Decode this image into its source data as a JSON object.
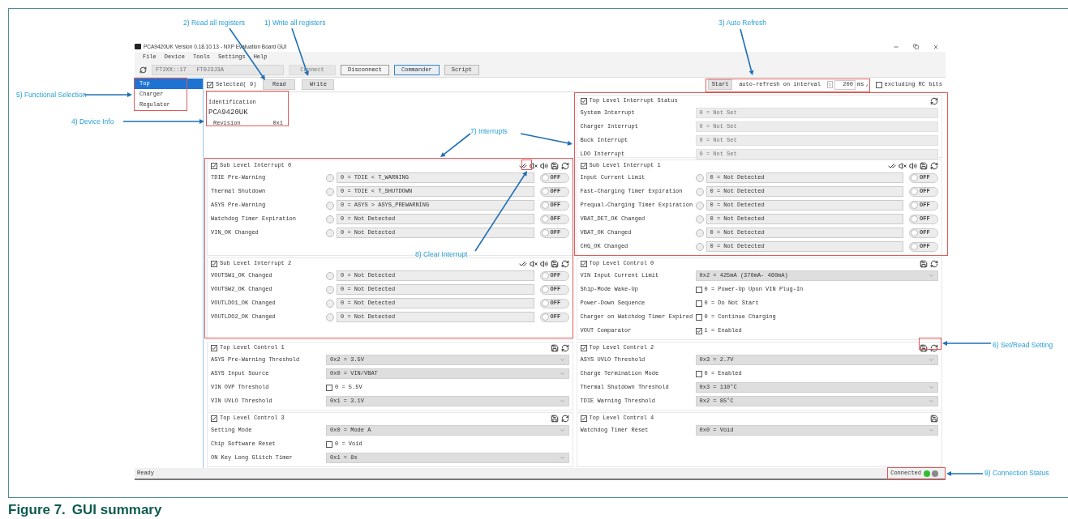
{
  "annotations": [
    {
      "text": "2) Read all registers"
    },
    {
      "text": "1) Write all registers"
    },
    {
      "text": "3) Auto Refresh"
    },
    {
      "text": "5) Functional Selection"
    },
    {
      "text": "4) Device Info"
    },
    {
      "text": "7) Interrupts"
    },
    {
      "text": "8) Clear Interrupt"
    },
    {
      "text": "6) Set/Read Setting"
    },
    {
      "text": "9) Connection Status"
    }
  ],
  "window": {
    "title": "PCA9420UK Version 0.18.10.13 - NXP Evaluation Board GUI"
  },
  "menu": [
    "File",
    "Device",
    "Tools",
    "Settings",
    "Help"
  ],
  "toolbar": {
    "device_combo": "FT2XX::17   FT0J3J3A",
    "connect_button": {
      "label": "Connect",
      "disabled": true
    },
    "disconnect_button": {
      "label": "Disconnect",
      "disabled": false
    },
    "mode_tabs": [
      {
        "label": "Commander",
        "selected": true
      },
      {
        "label": "Script",
        "selected": false
      }
    ]
  },
  "sidebar": {
    "items": [
      {
        "label": "Top",
        "selected": true
      },
      {
        "label": "Charger",
        "selected": false
      },
      {
        "label": "Regulator",
        "selected": false
      }
    ]
  },
  "register_bar": {
    "selected_checkbox": {
      "label": "Selected( 9)",
      "checked": true
    },
    "read_button": "Read",
    "write_button": "Write",
    "start_button": "Start",
    "interval_label": "auto-refresh on interval",
    "interval_value": "200",
    "unit": "ms",
    "separator": ",",
    "exclude_rc": {
      "label": "excluding RC bits",
      "checked": false
    }
  },
  "panels": [
    {
      "kind": "identification",
      "title": "Identification",
      "device": "PCA9420UK",
      "revision_label": "Revision",
      "revision_value": "0x1"
    },
    {
      "kind": "group",
      "title": "Top Level Interrupt Status",
      "checked": true,
      "tools": [
        {
          "kind": "refresh"
        }
      ],
      "rows": [
        {
          "kind": "status",
          "label": "System Interrupt",
          "value": "0 = Not Set"
        },
        {
          "kind": "status",
          "label": "Charger Interrupt",
          "value": "0 = Not Set"
        },
        {
          "kind": "status",
          "label": "Buck Interrupt",
          "value": "0 = Not Set"
        },
        {
          "kind": "status",
          "label": "LDO Interrupt",
          "value": "0 = Not Set"
        }
      ]
    },
    {
      "kind": "group",
      "title": "Sub Level Interrupt 0",
      "checked": true,
      "tools": [
        {
          "kind": "clear"
        },
        {
          "kind": "mute"
        },
        {
          "kind": "sound"
        },
        {
          "kind": "save"
        },
        {
          "kind": "refresh"
        }
      ],
      "rows": [
        {
          "kind": "interrupt",
          "label": "TDIE Pre-Warning",
          "value": "0 = TDIE < T_WARNING",
          "switch": "OFF",
          "on": false
        },
        {
          "kind": "interrupt",
          "label": "Thermal Shutdown",
          "value": "0 = TDIE < T_SHUTDOWN",
          "switch": "OFF",
          "on": false
        },
        {
          "kind": "interrupt",
          "label": "ASYS Pre-Warning",
          "value": "0 = ASYS > ASYS_PREWARNING",
          "switch": "OFF",
          "on": false
        },
        {
          "kind": "interrupt",
          "label": "Watchdog Timer Expiration",
          "value": "0 = Not Detected",
          "switch": "OFF",
          "on": false
        },
        {
          "kind": "interrupt",
          "label": "VIN_OK Changed",
          "value": "0 = Not Detected",
          "switch": "OFF",
          "on": false
        }
      ]
    },
    {
      "kind": "group",
      "title": "Sub Level Interrupt 1",
      "checked": true,
      "tools": [
        {
          "kind": "clear"
        },
        {
          "kind": "mute"
        },
        {
          "kind": "sound"
        },
        {
          "kind": "save"
        },
        {
          "kind": "refresh"
        }
      ],
      "rows": [
        {
          "kind": "interrupt",
          "label": "Input Current Limit",
          "value": "0 = Not Detected",
          "switch": "OFF",
          "on": false
        },
        {
          "kind": "interrupt",
          "label": "Fast-Charging Timer Expiration",
          "value": "0 = Not Detected",
          "switch": "OFF",
          "on": false
        },
        {
          "kind": "interrupt",
          "label": "Prequal-Charging Timer Expiration",
          "value": "0 = Not Detected",
          "switch": "OFF",
          "on": false
        },
        {
          "kind": "interrupt",
          "label": "VBAT_DET_OK Changed",
          "value": "0 = Not Detected",
          "switch": "OFF",
          "on": false
        },
        {
          "kind": "interrupt",
          "label": "VBAT_OK Changed",
          "value": "0 = Not Detected",
          "switch": "OFF",
          "on": false
        },
        {
          "kind": "interrupt",
          "label": "CHG_OK Changed",
          "value": "0 = Not Detected",
          "switch": "OFF",
          "on": false
        }
      ]
    },
    {
      "kind": "group",
      "title": "Sub Level Interrupt 2",
      "checked": true,
      "tools": [
        {
          "kind": "clear"
        },
        {
          "kind": "mute"
        },
        {
          "kind": "sound"
        },
        {
          "kind": "save"
        },
        {
          "kind": "refresh"
        }
      ],
      "rows": [
        {
          "kind": "interrupt",
          "label": "VOUTSW1_OK Changed",
          "value": "0 = Not Detected",
          "switch": "OFF",
          "on": false
        },
        {
          "kind": "interrupt",
          "label": "VOUTSW2_OK Changed",
          "value": "0 = Not Detected",
          "switch": "OFF",
          "on": false
        },
        {
          "kind": "interrupt",
          "label": "VOUTLDO1_OK Changed",
          "value": "0 = Not Detected",
          "switch": "OFF",
          "on": false
        },
        {
          "kind": "interrupt",
          "label": "VOUTLDO2_OK Changed",
          "value": "0 = Not Detected",
          "switch": "OFF",
          "on": false
        }
      ]
    },
    {
      "kind": "group",
      "title": "Top Level Control 0",
      "checked": true,
      "tools": [
        {
          "kind": "save"
        },
        {
          "kind": "refresh"
        }
      ],
      "rows": [
        {
          "kind": "select",
          "label": "VIN Input Current Limit",
          "value": "0x2 =  425mA (370mA- 460mA)"
        },
        {
          "kind": "checkbox",
          "label": "Ship-Mode Wake-Up",
          "value": "0 = Power-Up Upon VIN Plug-In",
          "checked": false
        },
        {
          "kind": "checkbox",
          "label": "Power-Down Sequence",
          "value": "0 = Do Not Start",
          "checked": false
        },
        {
          "kind": "checkbox",
          "label": "Charger on Watchdog Timer Expired",
          "value": "0 = Continue Charging",
          "checked": false
        },
        {
          "kind": "checkbox",
          "label": "VOUT Comparator",
          "value": "1 = Enabled",
          "checked": true
        }
      ]
    },
    {
      "kind": "group",
      "title": "Top Level Control 1",
      "checked": true,
      "tools": [
        {
          "kind": "save"
        },
        {
          "kind": "refresh"
        }
      ],
      "rows": [
        {
          "kind": "select",
          "label": "ASYS Pre-Warning Threshold",
          "value": "0x2 = 3.5V"
        },
        {
          "kind": "select",
          "label": "ASYS Input Source",
          "value": "0x0 = VIN/VBAT"
        },
        {
          "kind": "checkbox",
          "label": "VIN OVP Threshold",
          "value": "0 = 5.5V",
          "checked": false
        },
        {
          "kind": "select",
          "label": "VIN UVLO Threshold",
          "value": "0x1 = 3.1V"
        }
      ]
    },
    {
      "kind": "group",
      "title": "Top Level Control 2",
      "checked": true,
      "tools": [
        {
          "kind": "save"
        },
        {
          "kind": "refresh"
        }
      ],
      "rows": [
        {
          "kind": "select",
          "label": "ASYS UVLO Threshold",
          "value": "0x3 = 2.7V"
        },
        {
          "kind": "checkbox",
          "label": "Charge Termination Mode",
          "value": "0 = Enabled",
          "checked": false
        },
        {
          "kind": "select",
          "label": "Thermal Shutdown Threshold",
          "value": "0x3 = 110°C"
        },
        {
          "kind": "select",
          "label": "TDIE Warning Threshold",
          "value": "0x2 = 85°C"
        }
      ]
    },
    {
      "kind": "group",
      "title": "Top Level Control 3",
      "checked": true,
      "tools": [
        {
          "kind": "save"
        },
        {
          "kind": "refresh"
        }
      ],
      "rows": [
        {
          "kind": "select",
          "label": "Setting Mode",
          "value": "0x0 = Mode A"
        },
        {
          "kind": "checkbox",
          "label": "Chip Software Reset",
          "value": "0 = Void",
          "checked": false
        },
        {
          "kind": "select",
          "label": "ON Key Long Glitch Timer",
          "value": "0x1 =  8s"
        }
      ]
    },
    {
      "kind": "group",
      "title": "Top Level Control 4",
      "checked": true,
      "tools": [
        {
          "kind": "save"
        }
      ],
      "rows": [
        {
          "kind": "select",
          "label": "Watchdog Timer Reset",
          "value": "0x0 = Void"
        }
      ]
    }
  ],
  "status_bar": {
    "text": "Ready",
    "connection": "Connected",
    "leds": [
      {
        "color": "#33bb33"
      },
      {
        "color": "#8a8a8a"
      }
    ]
  },
  "caption": {
    "number": "Figure 7.",
    "title": "GUI summary"
  }
}
